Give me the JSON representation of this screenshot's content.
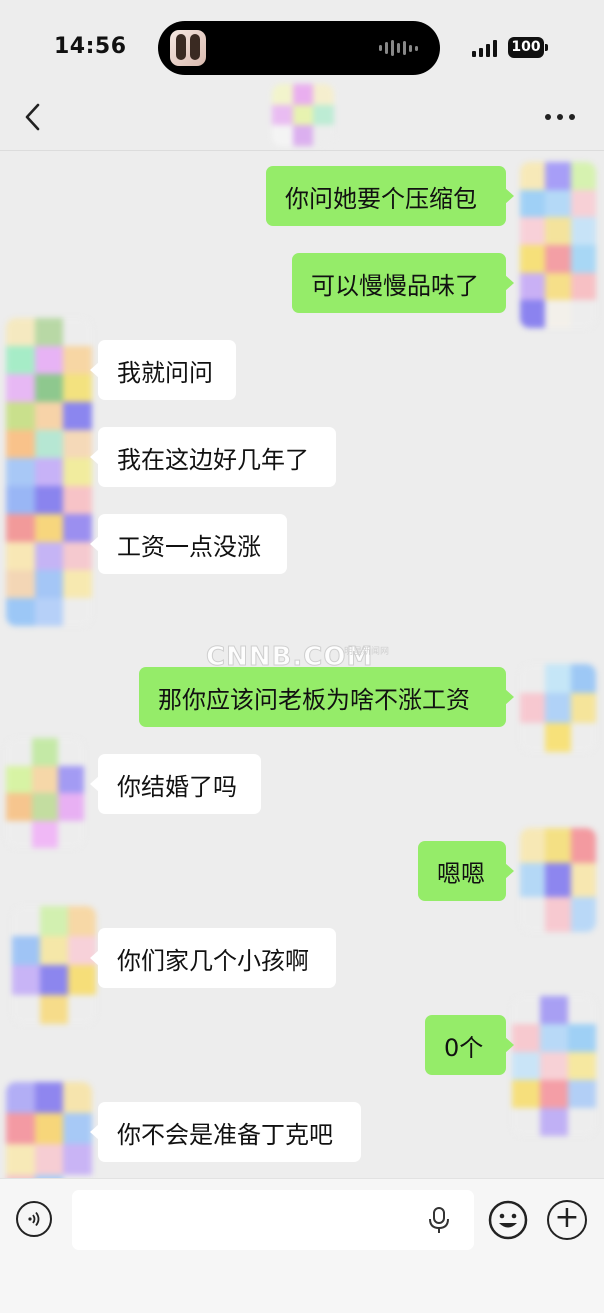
{
  "status_bar": {
    "time": "14:56",
    "battery": "100"
  },
  "nav": {
    "title": "",
    "back_icon": "chevron-left-icon",
    "more_icon": "more-icon"
  },
  "messages": [
    {
      "side": "out",
      "text": "你问她要个压缩包"
    },
    {
      "side": "out",
      "text": "可以慢慢品味了"
    },
    {
      "side": "in",
      "text": "我就问问"
    },
    {
      "side": "in",
      "text": "我在这边好几年了"
    },
    {
      "side": "in",
      "text": "工资一点没涨"
    },
    {
      "side": "out",
      "text": "那你应该问老板为啥不涨工资"
    },
    {
      "side": "in",
      "text": "你结婚了吗"
    },
    {
      "side": "out",
      "text": "嗯嗯"
    },
    {
      "side": "in",
      "text": "你们家几个小孩啊"
    },
    {
      "side": "out",
      "text": "0个"
    },
    {
      "side": "in",
      "text": "你不会是准备丁克吧"
    }
  ],
  "watermark": {
    "logo": "CNNB.COM",
    "sub": "明星新闻网"
  },
  "input_bar": {
    "voice_icon": "voice-icon",
    "mic_icon": "microphone-icon",
    "emoji_icon": "emoji-icon",
    "plus_icon": "plus-icon",
    "plus_glyph": "+"
  },
  "colors": {
    "outgoing_bubble": "#95ec69",
    "incoming_bubble": "#ffffff",
    "background": "#ededed"
  }
}
